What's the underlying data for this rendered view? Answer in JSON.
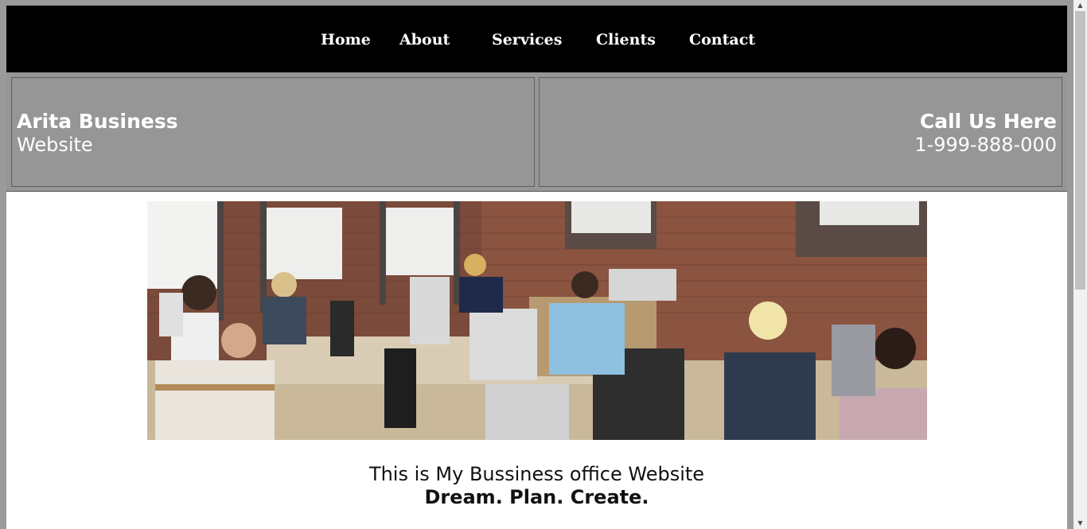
{
  "nav": {
    "items": [
      {
        "label": "Home"
      },
      {
        "label": "About"
      },
      {
        "label": "Services"
      },
      {
        "label": "Clients"
      },
      {
        "label": "Contact"
      }
    ]
  },
  "header": {
    "brand_title": "Arita Business",
    "brand_subtitle": "Website",
    "call_title": "Call Us Here",
    "call_phone": "1-999-888-000"
  },
  "main": {
    "tagline": "This is My Bussiness office Website",
    "motto": "Dream. Plan. Create."
  },
  "colors": {
    "nav_bg": "#000000",
    "header_bg": "#969696",
    "outer_bg": "#9a9a9a",
    "text_light": "#ffffff"
  }
}
